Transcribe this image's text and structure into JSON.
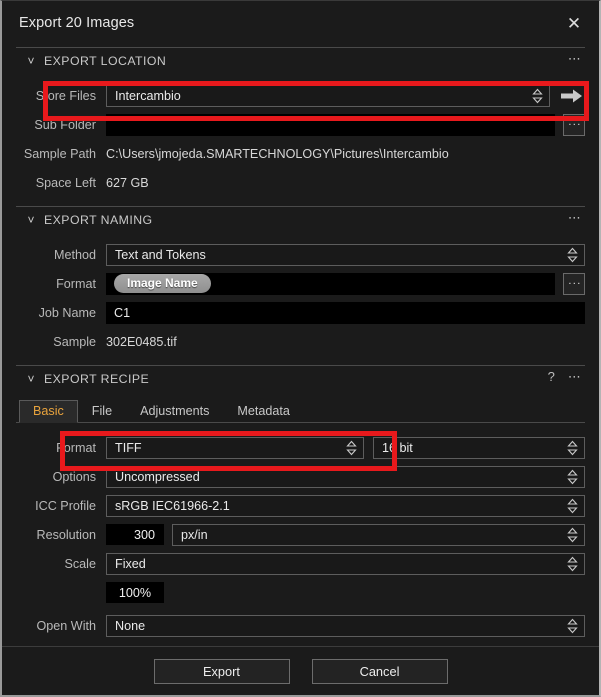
{
  "window": {
    "title": "Export 20 Images",
    "close_icon": "close-icon"
  },
  "highlights": {
    "accent_color": "#e8191c"
  },
  "export_location": {
    "header": "EXPORT LOCATION",
    "chevron_icon": "chevron-down-icon",
    "menu_icon": "ellipsis-icon",
    "store_files": {
      "label": "Store Files",
      "value": "Intercambio",
      "arrow_icon": "arrow-right-icon"
    },
    "sub_folder": {
      "label": "Sub Folder",
      "value": "",
      "browse_label": "..."
    },
    "sample_path": {
      "label": "Sample Path",
      "value": "C:\\Users\\jmojeda.SMARTECHNOLOGY\\Pictures\\Intercambio"
    },
    "space_left": {
      "label": "Space Left",
      "value": "627 GB"
    }
  },
  "export_naming": {
    "header": "EXPORT NAMING",
    "chevron_icon": "chevron-down-icon",
    "menu_icon": "ellipsis-icon",
    "method": {
      "label": "Method",
      "value": "Text and Tokens"
    },
    "format": {
      "label": "Format",
      "token": "Image Name",
      "browse_label": "..."
    },
    "job_name": {
      "label": "Job Name",
      "value": "C1"
    },
    "sample": {
      "label": "Sample",
      "value": "302E0485.tif"
    }
  },
  "export_recipe": {
    "header": "EXPORT RECIPE",
    "chevron_icon": "chevron-down-icon",
    "help_icon": "question-mark-icon",
    "menu_icon": "ellipsis-icon",
    "tabs": [
      {
        "label": "Basic",
        "active": true
      },
      {
        "label": "File",
        "active": false
      },
      {
        "label": "Adjustments",
        "active": false
      },
      {
        "label": "Metadata",
        "active": false
      }
    ],
    "active_tab_color": "#e8a33d",
    "format": {
      "label": "Format",
      "value": "TIFF",
      "bit_depth": "16 bit"
    },
    "options": {
      "label": "Options",
      "value": "Uncompressed"
    },
    "icc_profile": {
      "label": "ICC Profile",
      "value": "sRGB IEC61966-2.1"
    },
    "resolution": {
      "label": "Resolution",
      "value": "300",
      "unit": "px/in"
    },
    "scale": {
      "label": "Scale",
      "value": "Fixed",
      "percent": "100%"
    },
    "open_with": {
      "label": "Open With",
      "value": "None"
    }
  },
  "footer": {
    "export_label": "Export",
    "cancel_label": "Cancel"
  }
}
